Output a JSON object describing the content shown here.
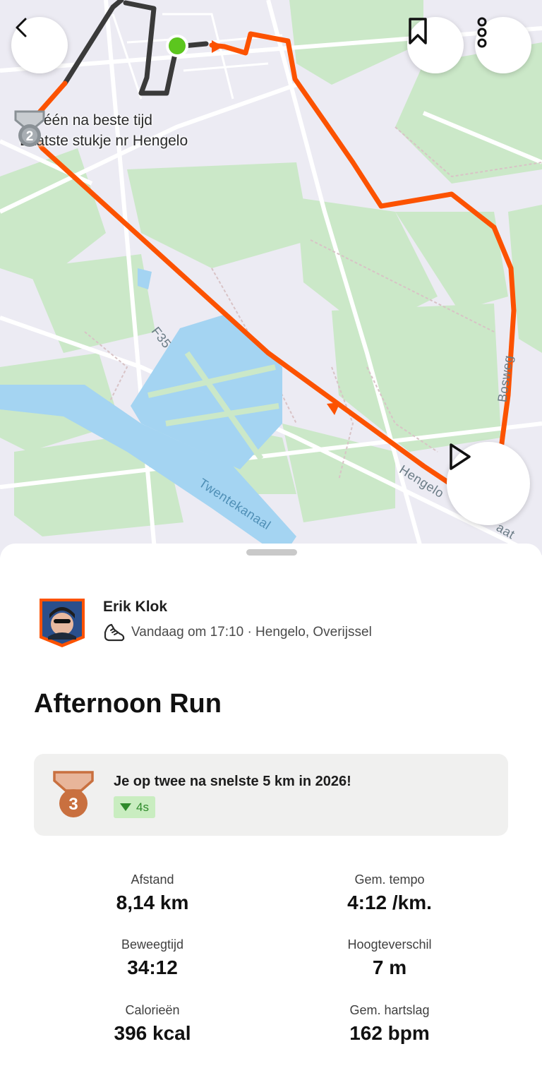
{
  "map": {
    "segment_rank": "2",
    "segment_line1": "Op één na beste tijd",
    "segment_line2": "Laatste stukje nr Hengelo",
    "road_labels": {
      "f35": "F35",
      "bosweg": "Bosweg",
      "hengelo_road": "Hengelo",
      "road_suffix": "aat",
      "canal": "Twentekanaal"
    }
  },
  "icons": {
    "back": "chevron-left-icon",
    "bookmark": "bookmark-icon",
    "more": "more-vertical-icon",
    "play": "play-icon",
    "run": "running-shoe-icon",
    "medal": "medal-icon"
  },
  "activity": {
    "athlete_name": "Erik Klok",
    "meta": "Vandaag om 17:10 · Hengelo, Overijssel",
    "title": "Afternoon Run"
  },
  "achievement": {
    "rank": "3",
    "text": "Je op twee na snelste 5 km in 2026!",
    "delta": "4s"
  },
  "stats": [
    {
      "label": "Afstand",
      "value": "8,14 km"
    },
    {
      "label": "Gem. tempo",
      "value": "4:12 /km."
    },
    {
      "label": "Beweegtijd",
      "value": "34:12"
    },
    {
      "label": "Hoogteverschil",
      "value": "7 m"
    },
    {
      "label": "Calorieën",
      "value": "396 kcal"
    },
    {
      "label": "Gem. hartslag",
      "value": "162 bpm"
    }
  ],
  "colors": {
    "route": "#fc5200",
    "route_dark": "#3a3a3a",
    "start": "#5cc61e",
    "water": "#a4d4f2",
    "green": "#cbe8c8",
    "bronze": "#c9703f",
    "silver": "#8a9196",
    "delta_bg": "#c9edc0"
  }
}
